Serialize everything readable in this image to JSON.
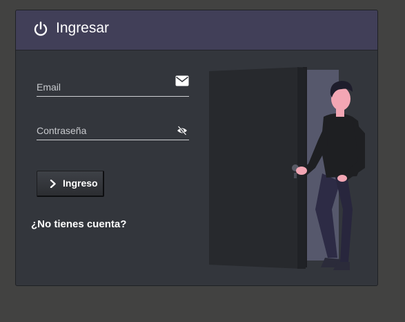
{
  "header": {
    "title": "Ingresar",
    "icon": "power-icon"
  },
  "form": {
    "email_placeholder": "Email",
    "email_icon": "envelope-icon",
    "password_placeholder": "Contraseña",
    "password_icon": "eye-slash-icon",
    "submit_label": "Ingreso",
    "submit_icon": "chevron-right-icon",
    "signup_link": "¿No tienes cuenta?"
  },
  "illustration": {
    "subject": "person-at-open-door-illustration"
  },
  "colors": {
    "background": "#424241",
    "card": "#33363c",
    "header": "#413f58",
    "text": "#ffffff"
  }
}
